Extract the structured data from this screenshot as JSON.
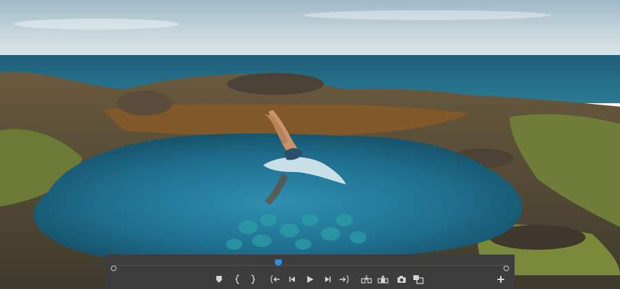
{
  "player": {
    "controls": [
      {
        "id": "add-marker",
        "icon": "marker-icon"
      },
      {
        "id": "mark-in",
        "icon": "mark-in-icon"
      },
      {
        "id": "mark-out",
        "icon": "mark-out-icon"
      },
      {
        "id": "go-to-in",
        "icon": "go-to-in-icon"
      },
      {
        "id": "step-back",
        "icon": "step-back-icon"
      },
      {
        "id": "play",
        "icon": "play-icon"
      },
      {
        "id": "step-forward",
        "icon": "step-forward-icon"
      },
      {
        "id": "go-to-out",
        "icon": "go-to-out-icon"
      },
      {
        "id": "insert",
        "icon": "insert-icon"
      },
      {
        "id": "overwrite",
        "icon": "overwrite-icon"
      },
      {
        "id": "export-frame",
        "icon": "camera-icon"
      },
      {
        "id": "compare",
        "icon": "compare-icon"
      },
      {
        "id": "button-editor",
        "icon": "plus-icon"
      }
    ],
    "playhead_fraction": 0.42,
    "colors": {
      "panel": "#3d3d3d",
      "icon": "#d6d6d6",
      "playhead": "#2d8ceb"
    }
  }
}
